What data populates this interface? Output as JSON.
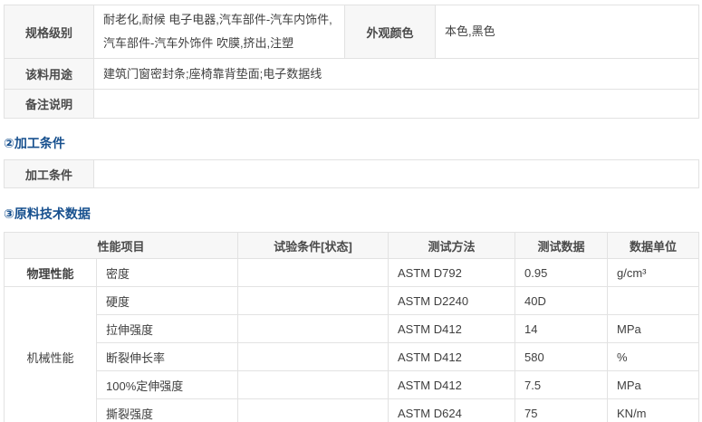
{
  "colors": {
    "section_title_blue": "#17508e",
    "border": "#e2e2e2",
    "label_background": "#f7f7f7",
    "text": "#404040"
  },
  "info_table": {
    "spec_label": "规格级别",
    "spec_value": "耐老化,耐候 电子电器,汽车部件-汽车内饰件,汽车部件-汽车外饰件 吹膜,挤出,注塑",
    "color_label": "外观颜色",
    "color_value": "本色,黑色",
    "usage_label": "该料用途",
    "usage_value": "建筑门窗密封条;座椅靠背垫面;电子数据线",
    "remark_label": "备注说明",
    "remark_value": ""
  },
  "processing_section": {
    "title": "②加工条件",
    "row_label": "加工条件",
    "row_value": ""
  },
  "tech_section": {
    "title": "③原料技术数据"
  },
  "tech_table": {
    "headers": {
      "property": "性能项目",
      "condition": "试验条件[状态]",
      "method": "测试方法",
      "data": "测试数据",
      "unit": "数据单位"
    },
    "groups": [
      {
        "name": "物理性能",
        "bold": true,
        "rows": [
          {
            "property": "密度",
            "condition": "",
            "method": "ASTM D792",
            "value": "0.95",
            "unit": "g/cm³"
          }
        ]
      },
      {
        "name": "机械性能",
        "bold": false,
        "rows": [
          {
            "property": "硬度",
            "condition": "",
            "method": "ASTM D2240",
            "value": "40D",
            "unit": ""
          },
          {
            "property": "拉伸强度",
            "condition": "",
            "method": "ASTM D412",
            "value": "14",
            "unit": "MPa"
          },
          {
            "property": "断裂伸长率",
            "condition": "",
            "method": "ASTM D412",
            "value": "580",
            "unit": "%"
          },
          {
            "property": "100%定伸强度",
            "condition": "",
            "method": "ASTM D412",
            "value": "7.5",
            "unit": "MPa"
          },
          {
            "property": "撕裂强度",
            "condition": "",
            "method": "ASTM D624",
            "value": "75",
            "unit": "KN/m"
          }
        ]
      }
    ]
  }
}
